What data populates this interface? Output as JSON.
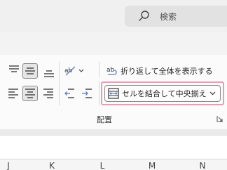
{
  "search": {
    "placeholder": "検索",
    "icon": "search-icon"
  },
  "alignment": {
    "top_align_icon": "align-top-icon",
    "middle_align_icon": "align-middle-icon",
    "bottom_align_icon": "align-bottom-icon",
    "orientation_icon": "text-orientation-icon",
    "align_left_icon": "align-left-icon",
    "center_icon": "align-center-icon",
    "align_right_icon": "align-right-icon",
    "decrease_indent_icon": "decrease-indent-icon",
    "increase_indent_icon": "increase-indent-icon",
    "wrap_text_label": "折り返して全体を表示する",
    "merge_center_label": "セルを結合して中央揃え",
    "group_label": "配置"
  },
  "columns": [
    "J",
    "K",
    "L",
    "M",
    "N"
  ],
  "colors": {
    "highlight_outline": "#ea9bb8",
    "selected_bg": "#e5e5e5"
  }
}
